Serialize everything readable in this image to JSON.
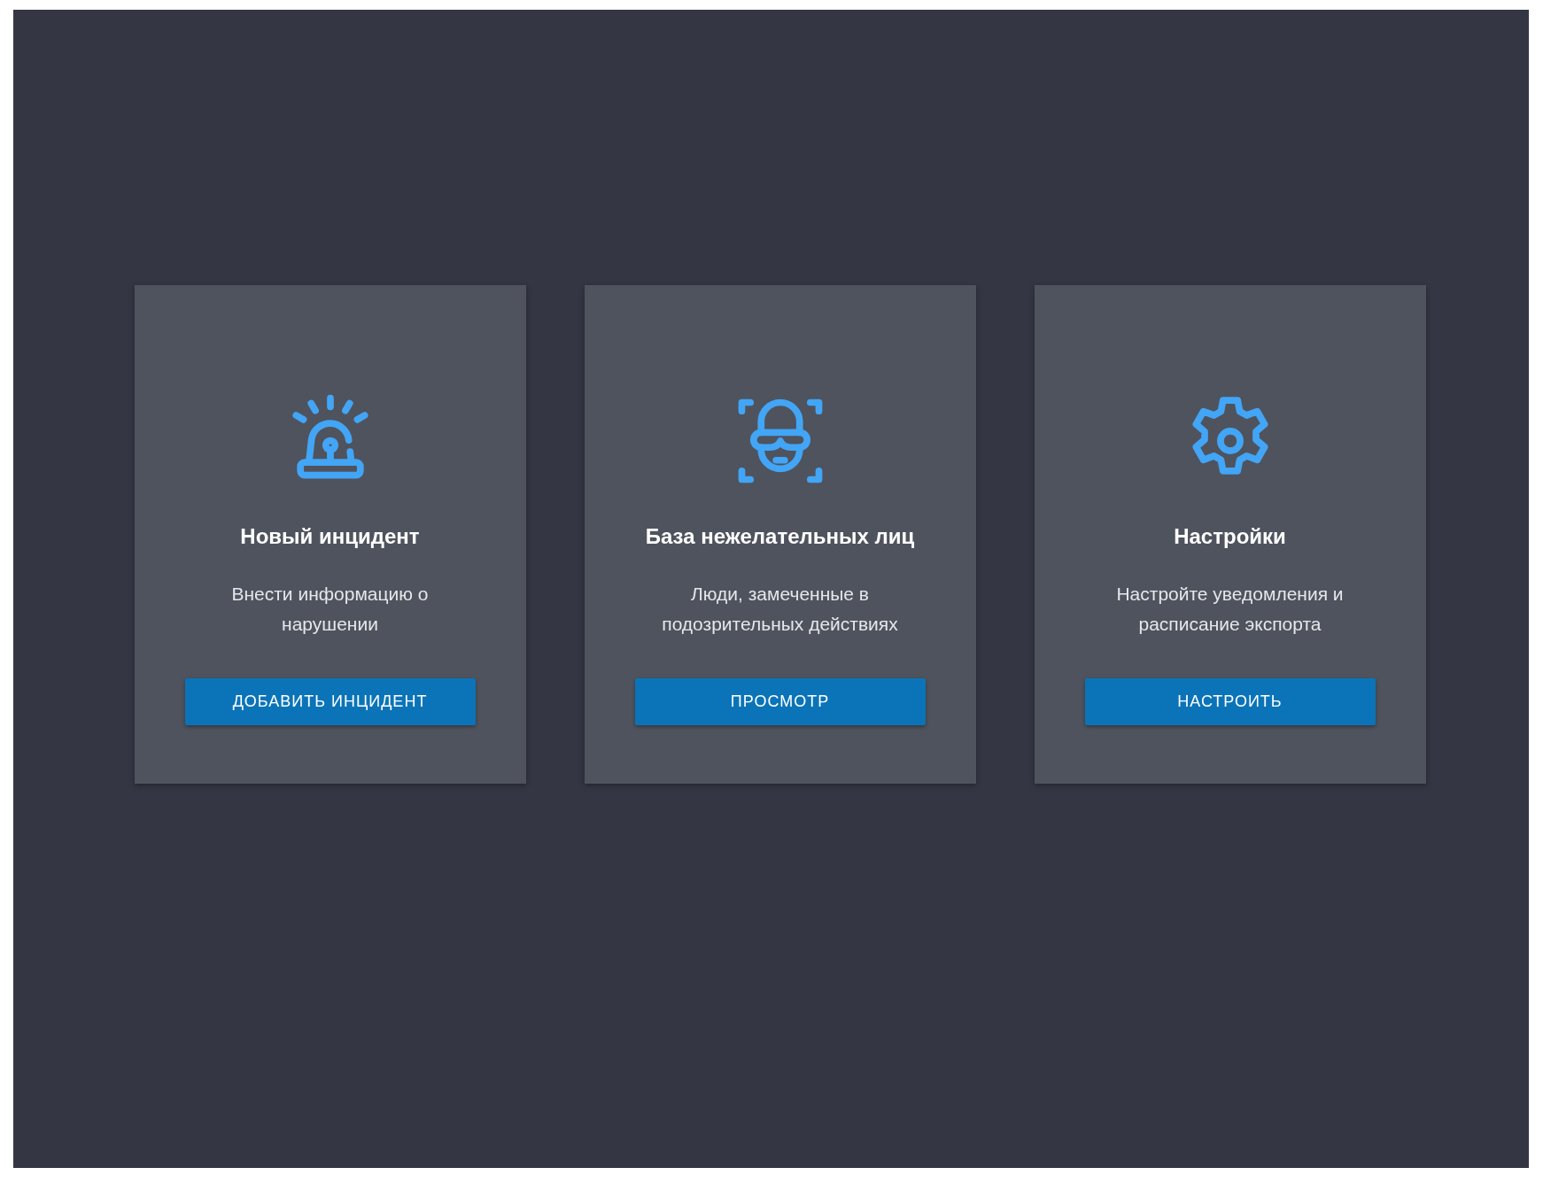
{
  "cards": [
    {
      "kind": "alarm",
      "title": "Новый инцидент",
      "description": "Внести информацию о нарушении",
      "button": "ДОБАВИТЬ ИНЦИДЕНТ"
    },
    {
      "kind": "face",
      "title": "База нежелательных лиц",
      "description": "Люди, замеченные в подозрительных действиях",
      "button": "ПРОСМОТР"
    },
    {
      "kind": "settings",
      "title": "Настройки",
      "description": "Настройте уведомления и расписание экспорта",
      "button": "НАСТРОИТЬ"
    }
  ]
}
